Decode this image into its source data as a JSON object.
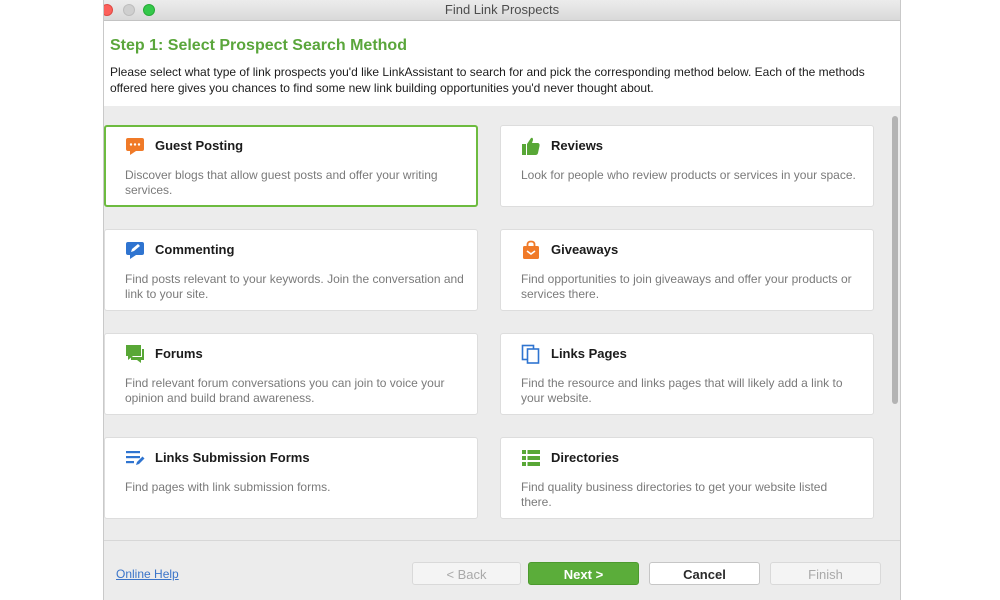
{
  "window": {
    "title": "Find Link Prospects"
  },
  "header": {
    "title": "Step 1: Select Prospect Search Method",
    "description": "Please select what type of link prospects you'd like LinkAssistant to search for and pick the corresponding method below. Each of the methods offered here gives you chances to find some new link building opportunities you'd never thought about."
  },
  "methods": [
    {
      "title": "Guest Posting",
      "desc": "Discover blogs that allow guest posts and offer your writing services.",
      "icon": "speech-bubble-icon",
      "selected": true
    },
    {
      "title": "Reviews",
      "desc": "Look for people who review products or services in your space.",
      "icon": "thumbs-up-icon"
    },
    {
      "title": "Commenting",
      "desc": "Find posts relevant to your keywords. Join the conversation and link to your site.",
      "icon": "comment-pen-icon"
    },
    {
      "title": "Giveaways",
      "desc": "Find opportunities to join giveaways and offer your products or services there.",
      "icon": "gift-bag-icon"
    },
    {
      "title": "Forums",
      "desc": "Find relevant forum conversations you can join to voice your opinion and build brand awareness.",
      "icon": "forum-chat-icon"
    },
    {
      "title": "Links Pages",
      "desc": "Find the resource and links pages that will likely add a link to your website.",
      "icon": "pages-icon"
    },
    {
      "title": "Links Submission Forms",
      "desc": "Find pages with link submission forms.",
      "icon": "form-edit-icon"
    },
    {
      "title": "Directories",
      "desc": "Find quality business directories to get your website listed there.",
      "icon": "directory-list-icon"
    }
  ],
  "footer": {
    "help": "Online Help",
    "back": "< Back",
    "next": "Next >",
    "cancel": "Cancel",
    "finish": "Finish"
  },
  "colors": {
    "accent": "#5aa63b",
    "orange": "#f07a28",
    "blue": "#2f74d0",
    "green": "#58a736"
  }
}
